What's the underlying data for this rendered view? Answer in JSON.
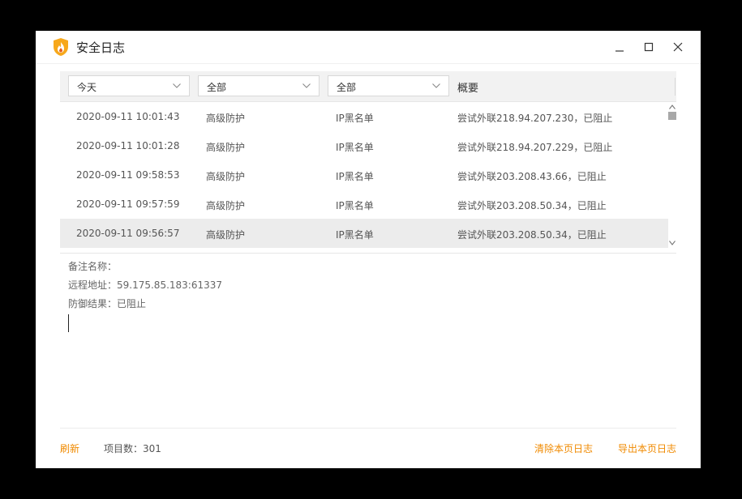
{
  "window": {
    "title": "安全日志",
    "logo": "flame-shield-icon",
    "controls": [
      "minimize-icon",
      "maximize-icon",
      "close-icon"
    ]
  },
  "filters": {
    "time": {
      "selected": "今天"
    },
    "level": {
      "selected": "全部"
    },
    "type": {
      "selected": "全部"
    },
    "summary_header": "概要"
  },
  "logs": [
    {
      "time": "2020-09-11 10:01:43",
      "level": "高级防护",
      "type": "IP黑名单",
      "summary": "尝试外联218.94.207.230，已阻止"
    },
    {
      "time": "2020-09-11 10:01:28",
      "level": "高级防护",
      "type": "IP黑名单",
      "summary": "尝试外联218.94.207.229，已阻止"
    },
    {
      "time": "2020-09-11 09:58:53",
      "level": "高级防护",
      "type": "IP黑名单",
      "summary": "尝试外联203.208.43.66，已阻止"
    },
    {
      "time": "2020-09-11 09:57:59",
      "level": "高级防护",
      "type": "IP黑名单",
      "summary": "尝试外联203.208.50.34，已阻止"
    },
    {
      "time": "2020-09-11 09:56:57",
      "level": "高级防护",
      "type": "IP黑名单",
      "summary": "尝试外联203.208.50.34，已阻止"
    }
  ],
  "selected_row": 4,
  "details": {
    "note_label": "备注名称：",
    "remote_line": "远程地址：59.175.85.183:61337",
    "result_line": "防御结果：已阻止"
  },
  "footer": {
    "refresh": "刷新",
    "count": "项目数：301",
    "clear": "清除本页日志",
    "export": "导出本页日志"
  },
  "colors": {
    "accent": "#f08a00",
    "selected_row": "#ececec",
    "header_bg": "#f2f2f2"
  }
}
